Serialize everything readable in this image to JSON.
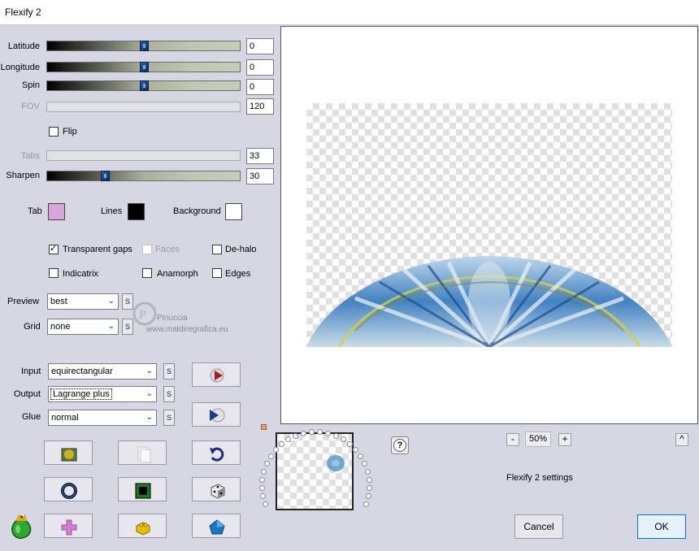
{
  "window": {
    "title": "Flexify 2"
  },
  "sliders": [
    {
      "label": "Latitude",
      "value": "0",
      "level": 0.5,
      "enabled": true
    },
    {
      "label": "Longitude",
      "value": "0",
      "level": 0.5,
      "enabled": true
    },
    {
      "label": "Spin",
      "value": "0",
      "level": 0.5,
      "enabled": true
    },
    {
      "label": "FOV",
      "value": "120",
      "enabled": false
    },
    {
      "label": "Tabs",
      "value": "33",
      "enabled": false
    },
    {
      "label": "Sharpen",
      "value": "30",
      "level": 0.3,
      "enabled": true
    }
  ],
  "flip": {
    "label": "Flip",
    "checked": false
  },
  "colors": {
    "tab": {
      "label": "Tab",
      "color": "#d7a6d8"
    },
    "lines": {
      "label": "Lines",
      "color": "#000000"
    },
    "background": {
      "label": "Background",
      "color": "#ffffff"
    }
  },
  "options": {
    "transparent_gaps": {
      "label": "Transparent gaps",
      "checked": true
    },
    "faces": {
      "label": "Faces",
      "checked": false,
      "enabled": false
    },
    "dehalo": {
      "label": "De-halo",
      "checked": false
    },
    "indicatrix": {
      "label": "Indicatrix",
      "checked": false
    },
    "anamorph": {
      "label": "Anamorph",
      "checked": false
    },
    "edges": {
      "label": "Edges",
      "checked": false
    }
  },
  "preview_select": {
    "label": "Preview",
    "value": "best"
  },
  "grid_select": {
    "label": "Grid",
    "value": "none"
  },
  "input_select": {
    "label": "Input",
    "value": "equirectangular"
  },
  "output_select": {
    "label": "Output",
    "value": "Lagrange plus"
  },
  "glue_select": {
    "label": "Glue",
    "value": "normal"
  },
  "s_button": "S",
  "watermark": {
    "name": "Pinuccia",
    "url": "www.maldiregrafica.eu"
  },
  "zoom": {
    "minus": "-",
    "value": "50%",
    "plus": "+"
  },
  "help": "?",
  "collapse": "^",
  "settings_label": "Flexify 2 settings",
  "buttons": {
    "cancel": "Cancel",
    "ok": "OK"
  }
}
